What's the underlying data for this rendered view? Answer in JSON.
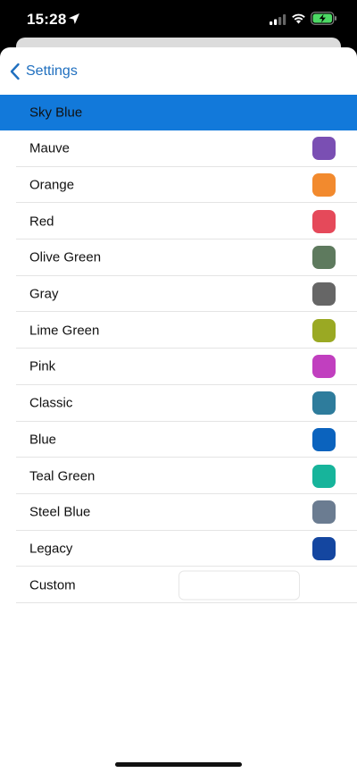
{
  "status_bar": {
    "time": "15:28",
    "icons": [
      "location-arrow-icon",
      "cellular-signal-icon",
      "wifi-icon",
      "battery-charging-icon"
    ]
  },
  "nav": {
    "back_label": "Settings",
    "back_icon": "chevron-left-icon",
    "accent_color": "#1f6fbf"
  },
  "selected": {
    "label": "Sky Blue",
    "color": "#1279da"
  },
  "colors": [
    {
      "label": "Mauve",
      "swatch": "#7a4fb3"
    },
    {
      "label": "Orange",
      "swatch": "#f28a2e"
    },
    {
      "label": "Red",
      "swatch": "#e5495a"
    },
    {
      "label": "Olive Green",
      "swatch": "#5e7a5e"
    },
    {
      "label": "Gray",
      "swatch": "#666666"
    },
    {
      "label": "Lime Green",
      "swatch": "#9aa923"
    },
    {
      "label": "Pink",
      "swatch": "#c13fbf"
    },
    {
      "label": "Classic",
      "swatch": "#2e7c9c"
    },
    {
      "label": "Blue",
      "swatch": "#0b63be"
    },
    {
      "label": "Teal Green",
      "swatch": "#17b49b"
    },
    {
      "label": "Steel Blue",
      "swatch": "#6b7c91"
    },
    {
      "label": "Legacy",
      "swatch": "#1446a0"
    }
  ],
  "custom": {
    "label": "Custom",
    "value": "",
    "placeholder": ""
  }
}
